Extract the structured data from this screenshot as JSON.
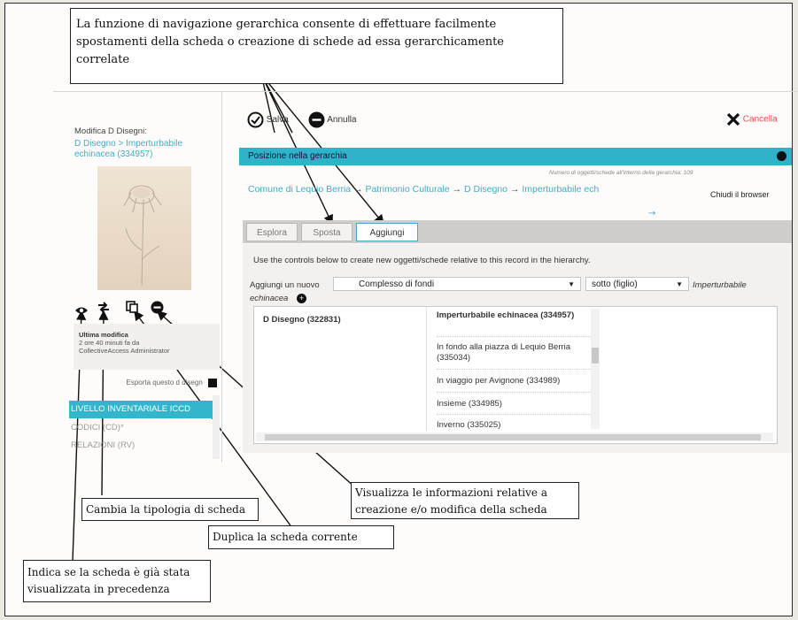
{
  "callouts": {
    "navigation": "La funzione di navigazione gerarchica consente di effettuare facilmente spostamenti della scheda o creazione di schede ad essa gerarchicamente correlate",
    "info": "Visualizza le informazioni relative a creazione e/o modifica della scheda",
    "change_type": "Cambia la tipologia di scheda",
    "duplicate": "Duplica la scheda corrente",
    "viewed": "Indica se la scheda è già stata visualizzata in precedenza"
  },
  "left_panel": {
    "edit_title": "Modifica D Disegni:",
    "record_link": "D Disegno > Imperturbabile echinacea (334957)",
    "last_modified_title": "Ultima modifica",
    "last_modified_text": "2 ore 40 minuti fa da CollectiveAccess Administrator",
    "export_label": "Esporta questo d disegn",
    "nav_items": [
      "LIVELLO INVENTARIALE ICCD",
      "CODICI (CD)*",
      "RELAZIONI (RV)"
    ]
  },
  "toolbar": {
    "save_label": "Salva",
    "cancel_label": "Annulla",
    "delete_label": "Cancella"
  },
  "hierarchy": {
    "title": "Posizione nella gerarchia",
    "count_note": "Numero di oggetti/schede all'interno della gerarchia: 109",
    "breadcrumb": [
      "Comune di Lequio Berria",
      "Patrimonio Culturale",
      "D Disegno",
      "Imperturbabile ech"
    ],
    "close_browser": "Chiudi il browser",
    "tabs": [
      "Esplora",
      "Sposta",
      "Aggiungi"
    ],
    "active_tab": "Aggiungi",
    "hint": "Use the controls below to create new oggetti/schede relative to this record in the hierarchy.",
    "add_label": "Aggiungi un nuovo",
    "type_select": "Complesso di fondi",
    "position_select": "sotto (figlio)",
    "target_part1": "Imperturbabile",
    "target_part2": "echinacea",
    "col1_items": [
      "D Disegno (322831)"
    ],
    "col2_items": [
      "Imperturbabile echinacea (334957)",
      "In fondo alla piazza di Lequio Berria (335034)",
      "In viaggio per Avignone (334989)",
      "Insieme (334985)",
      "Inverno (335025)"
    ]
  },
  "colors": {
    "accent": "#2fb3cb",
    "link": "#48aac2",
    "delete": "#d9534f"
  }
}
